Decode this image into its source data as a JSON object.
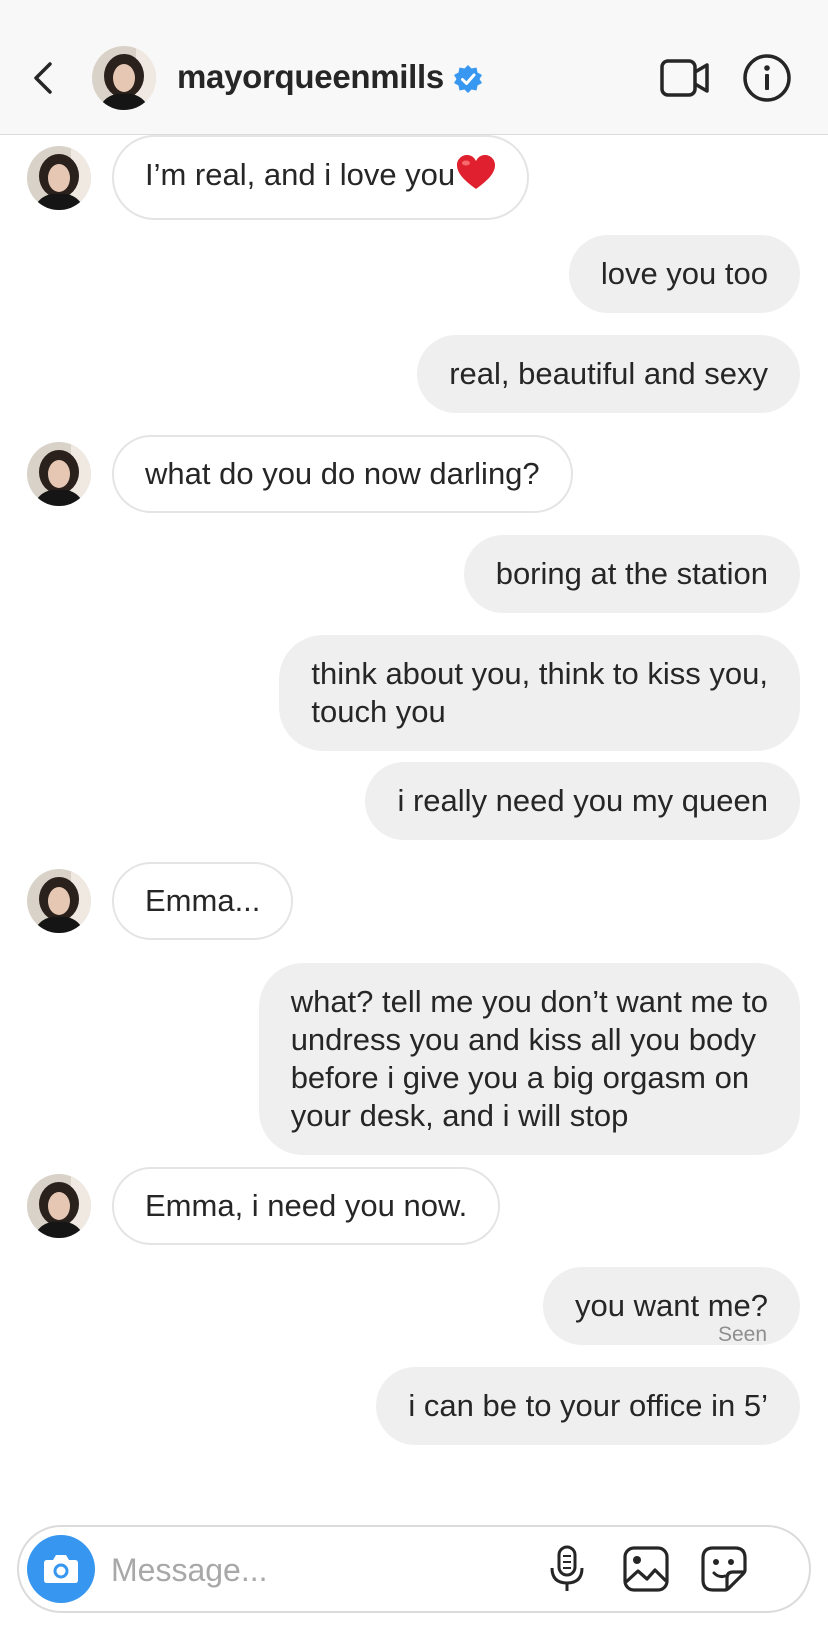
{
  "header": {
    "username": "mayorqueenmills",
    "verified": true,
    "back_icon": "chevron-left-icon",
    "video_icon": "video-camera-icon",
    "info_icon": "info-icon"
  },
  "messages": [
    {
      "side": "in",
      "text": "I’m real, and i love you",
      "emoji": "heart"
    },
    {
      "side": "out",
      "text": "love you too"
    },
    {
      "side": "out",
      "text": "real, beautiful and sexy"
    },
    {
      "side": "in",
      "text": "what do you do now darling?"
    },
    {
      "side": "out",
      "text": "boring at the station"
    },
    {
      "side": "out",
      "text": "think about you, think to kiss you,\ntouch you"
    },
    {
      "side": "out",
      "text": "i really need you my queen"
    },
    {
      "side": "in",
      "text": "Emma..."
    },
    {
      "side": "out",
      "text": "what? tell me you don’t want me to\nundress you and kiss all you body\nbefore i give you a big orgasm on\nyour desk, and i will stop"
    },
    {
      "side": "in",
      "text": "Emma, i need you now."
    },
    {
      "side": "out",
      "text": "you want me?"
    },
    {
      "side": "out",
      "text": "i can be to your office in 5’"
    }
  ],
  "seen_label": "Seen",
  "composer": {
    "placeholder": "Message...",
    "icons": [
      "camera-icon",
      "microphone-icon",
      "gallery-icon",
      "sticker-icon"
    ]
  },
  "colors": {
    "accent": "#3797f0",
    "outgoing_bubble": "#efefef",
    "incoming_border": "#e4e4e4",
    "heart": "#e0202e"
  }
}
